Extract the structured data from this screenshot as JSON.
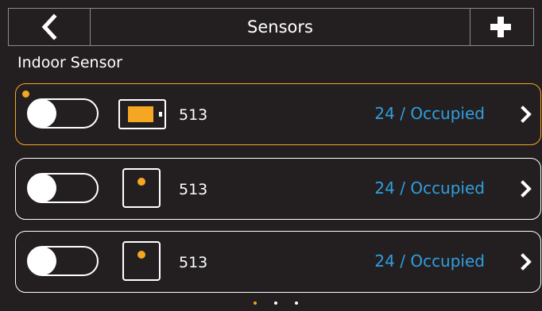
{
  "header": {
    "title": "Sensors",
    "back_icon": "chevron-left-icon",
    "add_icon": "plus-icon"
  },
  "section": {
    "label": "Indoor Sensor"
  },
  "sensors": [
    {
      "number": "513",
      "status": "24 / Occupied",
      "enabled": false,
      "selected": true,
      "icon": "battery-icon"
    },
    {
      "number": "513",
      "status": "24 / Occupied",
      "enabled": false,
      "selected": false,
      "icon": "sensor-icon"
    },
    {
      "number": "513",
      "status": "24 / Occupied",
      "enabled": false,
      "selected": false,
      "icon": "sensor-icon"
    }
  ],
  "pager": {
    "count": 3,
    "active": 0
  },
  "colors": {
    "accent": "#f5a623",
    "status_text": "#2f9fe0",
    "background": "#231f20"
  }
}
